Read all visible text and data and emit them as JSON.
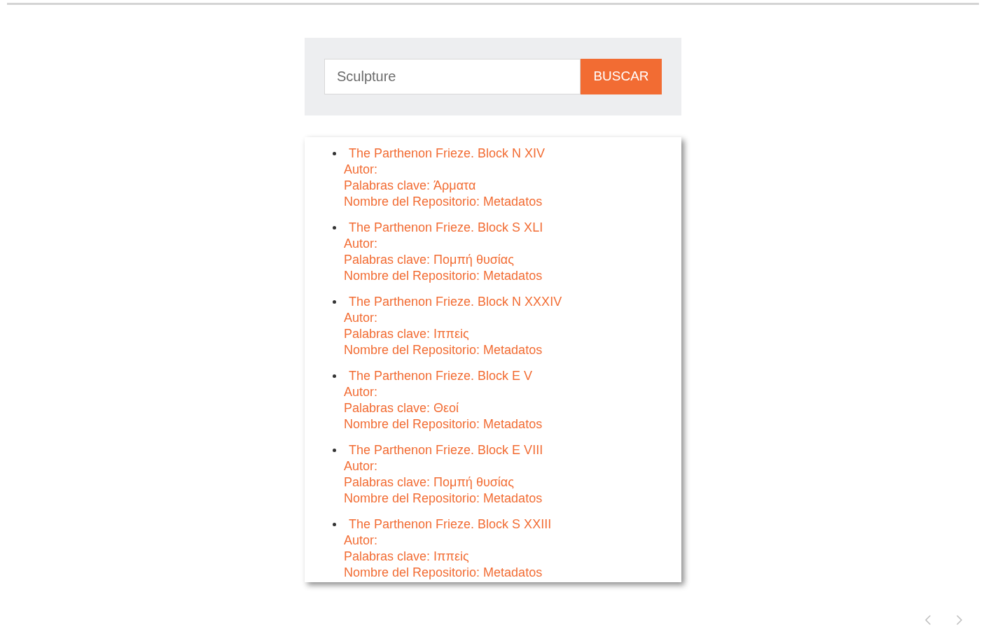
{
  "search": {
    "value": "Sculpture",
    "button": "BUSCAR"
  },
  "results": [
    {
      "title": "The Parthenon Frieze. Block N XIV",
      "author": "Autor:",
      "keywords": "Palabras clave: Άρματα",
      "repository": "Nombre del Repositorio: Metadatos"
    },
    {
      "title": "The Parthenon Frieze. Block S XLI",
      "author": "Autor:",
      "keywords": "Palabras clave: Πομπή θυσίας",
      "repository": "Nombre del Repositorio: Metadatos"
    },
    {
      "title": "The Parthenon Frieze. Block N XXXIV",
      "author": "Autor:",
      "keywords": "Palabras clave: Ιππεiς",
      "repository": "Nombre del Repositorio: Metadatos"
    },
    {
      "title": "The Parthenon Frieze. Block E V",
      "author": "Autor:",
      "keywords": "Palabras clave: Θεοί",
      "repository": "Nombre del Repositorio: Metadatos"
    },
    {
      "title": "The Parthenon Frieze. Block E VIII",
      "author": "Autor:",
      "keywords": "Palabras clave: Πομπή θυσίας",
      "repository": "Nombre del Repositorio: Metadatos"
    },
    {
      "title": "The Parthenon Frieze. Block S XXIII",
      "author": "Autor:",
      "keywords": "Palabras clave: Ιππεiς",
      "repository": "Nombre del Repositorio: Metadatos"
    }
  ]
}
